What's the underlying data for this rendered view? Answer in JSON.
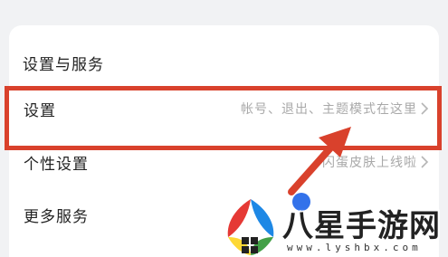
{
  "section": {
    "title": "设置与服务"
  },
  "rows": [
    {
      "label": "设置",
      "hint": "帐号、退出、主题模式在这里",
      "chevron": "chevron-right-icon"
    },
    {
      "label": "个性设置",
      "hint": "闪蛋皮肤上线啦",
      "chevron": "chevron-right-icon"
    },
    {
      "label": "更多服务",
      "hint": "",
      "chevron": "chevron-right-icon"
    }
  ],
  "annotation": {
    "color": "#d9412c",
    "shapes": [
      "highlight-box",
      "arrow"
    ]
  },
  "watermark": {
    "text": "八星手游网",
    "url": "www.lyshbx.com",
    "logo": "watermark-logo-icon"
  },
  "colors": {
    "background": "#f1f2f4",
    "card": "#ffffff",
    "accent": "#3372ea",
    "hint": "#a9a9a9"
  }
}
